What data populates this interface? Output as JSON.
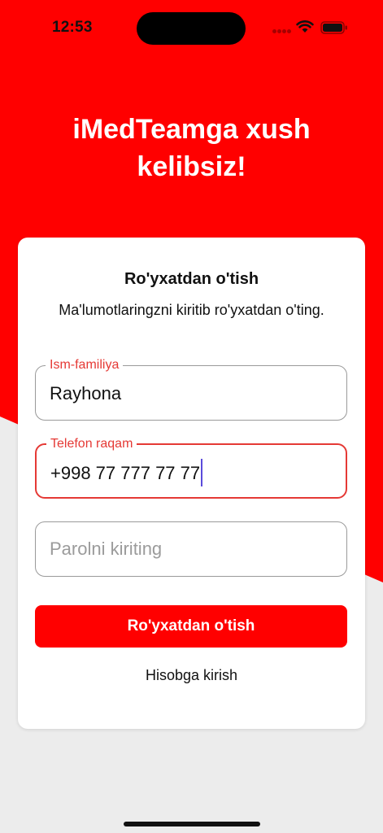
{
  "status_bar": {
    "time": "12:53"
  },
  "welcome": {
    "line1": "iMedTeamga xush",
    "line2": "kelibsiz!"
  },
  "card": {
    "title": "Ro'yxatdan o'tish",
    "subtitle": "Ma'lumotlaringzni kiritib ro'yxatdan o'ting."
  },
  "form": {
    "name_field": {
      "label": "Ism-familiya",
      "value": "Rayhona"
    },
    "phone_field": {
      "label": "Telefon raqam",
      "value": "+998 77 777 77 77"
    },
    "password_field": {
      "placeholder": "Parolni kiriting"
    },
    "submit_label": "Ro'yxatdan o'tish",
    "login_link": "Hisobga kirish"
  },
  "colors": {
    "brand_red": "#ff0000",
    "active_border": "#e53935",
    "background": "#ececec"
  },
  "icons": [
    "cellular-signal-icon",
    "wifi-icon",
    "battery-icon"
  ]
}
